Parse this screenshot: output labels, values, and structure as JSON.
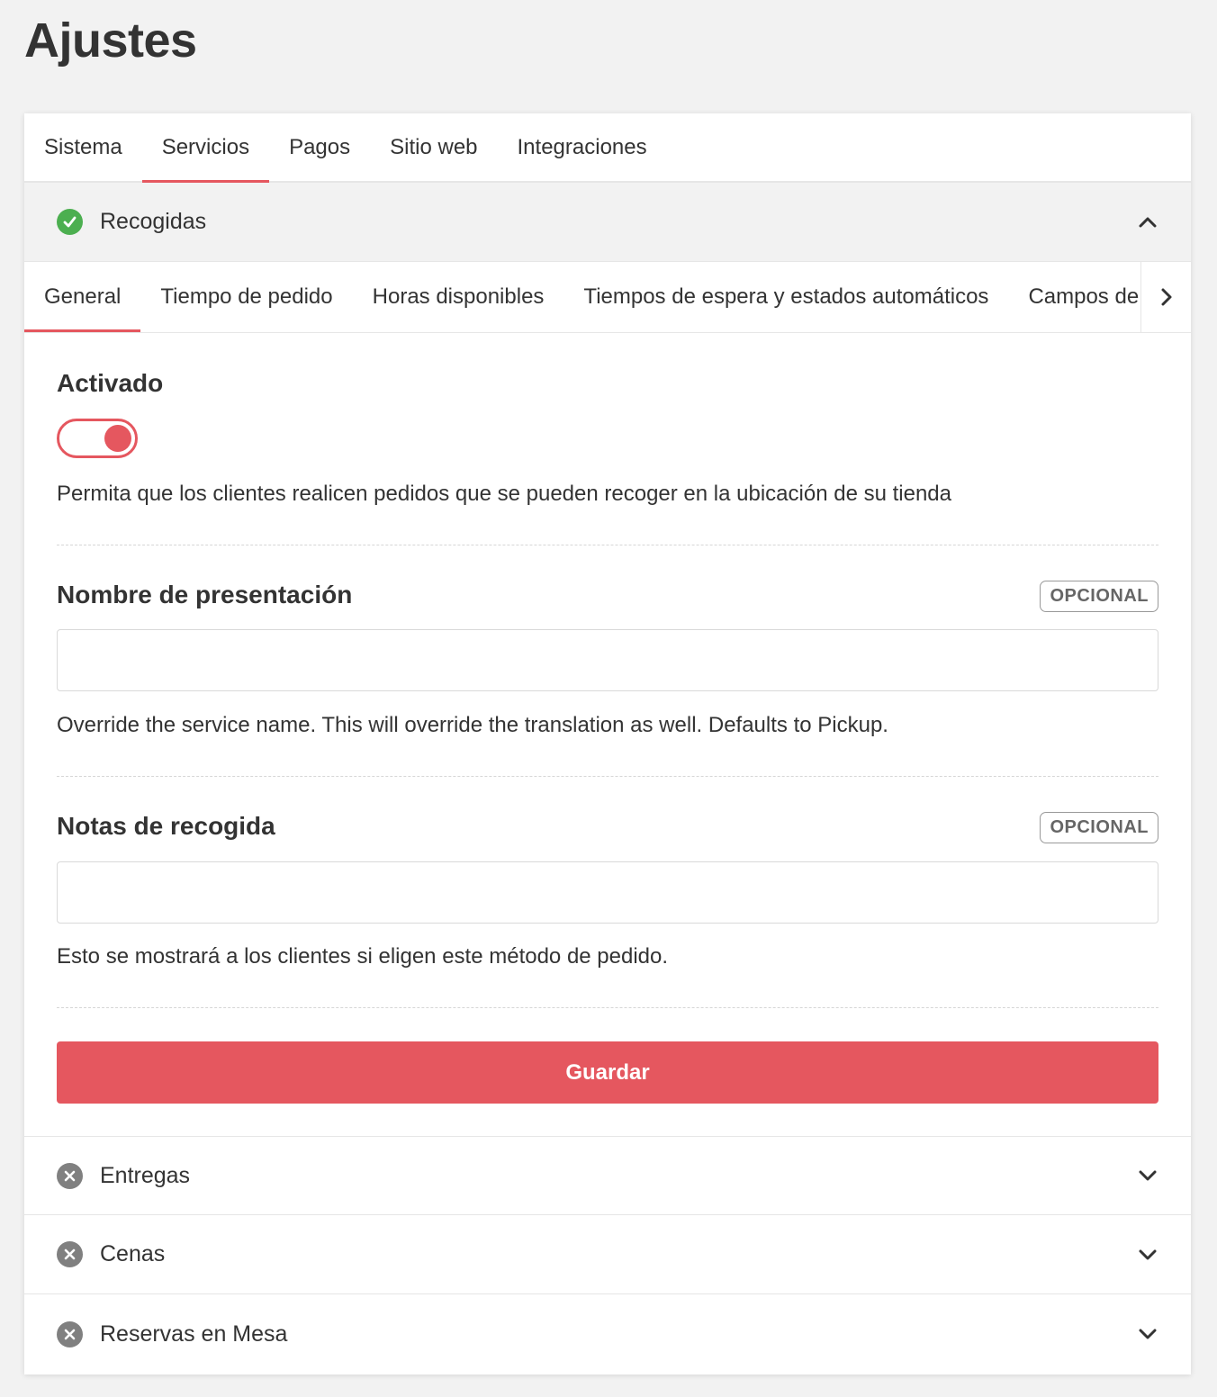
{
  "page": {
    "title": "Ajustes"
  },
  "top_tabs": [
    {
      "label": "Sistema",
      "active": false
    },
    {
      "label": "Servicios",
      "active": true
    },
    {
      "label": "Pagos",
      "active": false
    },
    {
      "label": "Sitio web",
      "active": false
    },
    {
      "label": "Integraciones",
      "active": false
    }
  ],
  "services": {
    "open": {
      "title": "Recogidas",
      "status_icon": "check-circle-icon",
      "expanded": true,
      "sub_tabs": [
        {
          "label": "General",
          "active": true
        },
        {
          "label": "Tiempo de pedido",
          "active": false
        },
        {
          "label": "Horas disponibles",
          "active": false
        },
        {
          "label": "Tiempos de espera y estados automáticos",
          "active": false
        },
        {
          "label": "Campos de",
          "active": false
        }
      ],
      "form": {
        "enabled_label": "Activado",
        "enabled_value": true,
        "enabled_help": "Permita que los clientes realicen pedidos que se pueden recoger en la ubicación de su tienda",
        "display_name_label": "Nombre de presentación",
        "display_name_badge": "OPCIONAL",
        "display_name_value": "",
        "display_name_help": "Override the service name. This will override the translation as well. Defaults to Pickup.",
        "notes_label": "Notas de recogida",
        "notes_badge": "OPCIONAL",
        "notes_value": "",
        "notes_help": "Esto se mostrará a los clientes si eligen este método de pedido.",
        "save_label": "Guardar"
      }
    },
    "collapsed": [
      {
        "title": "Entregas",
        "status_icon": "x-circle-icon"
      },
      {
        "title": "Cenas",
        "status_icon": "x-circle-icon"
      },
      {
        "title": "Reservas en Mesa",
        "status_icon": "x-circle-icon"
      }
    ]
  },
  "colors": {
    "accent": "#e5575f",
    "success": "#4caf50",
    "disabled": "#808080",
    "background": "#f2f2f2"
  }
}
